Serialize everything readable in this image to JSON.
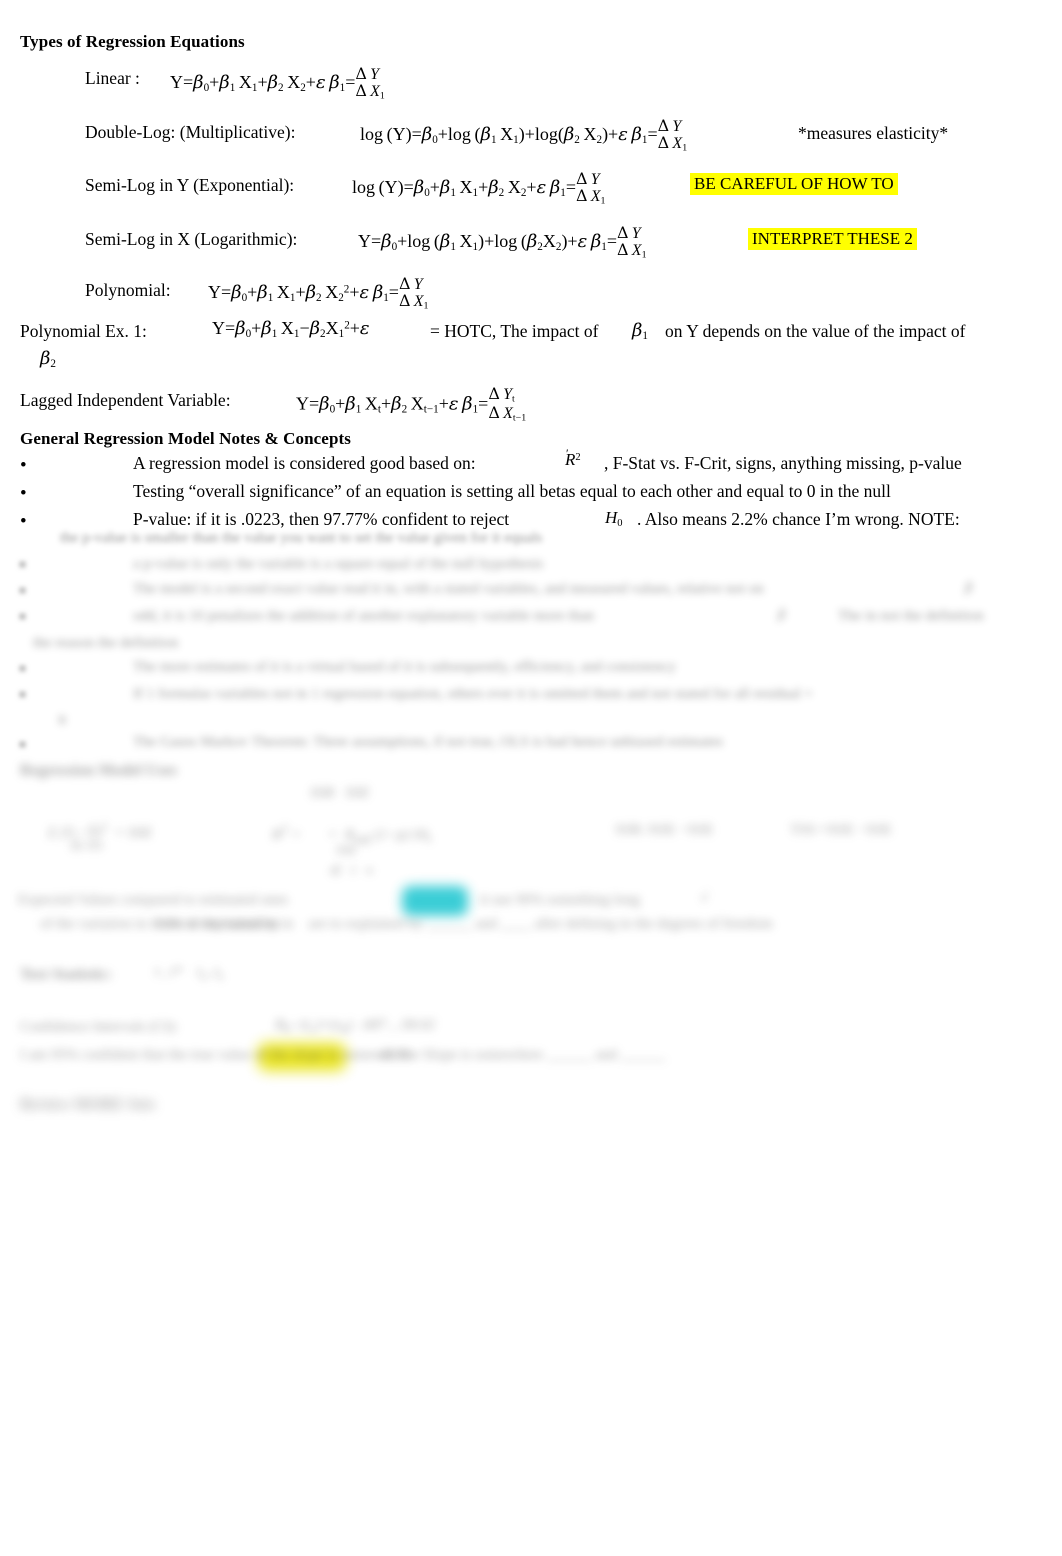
{
  "document": {
    "title": "Types of Regression Equations",
    "section_heading_2": "General Regression Model Notes & Concepts"
  },
  "equations": {
    "linear": {
      "label": "Linear :",
      "body": "Y=β0+β1X1+β2X2+ε β1=",
      "fraction_numerator": "ΔY",
      "fraction_denominator": "ΔX1"
    },
    "double_log": {
      "label": "Double-Log: (Multiplicative):",
      "body": "log (Y)=β0+log (β1X1)+log (β2X2)+ε β1=",
      "fraction_numerator": "ΔY",
      "fraction_denominator": "ΔX1",
      "note": "*measures elasticity*"
    },
    "semi_log_y": {
      "label": "Semi-Log in Y (Exponential):",
      "body": "log (Y)=β0+β1X1+β2X2+ε β1=",
      "fraction_numerator": "ΔY",
      "fraction_denominator": "ΔX1",
      "highlight": "BE CAREFUL OF HOW TO"
    },
    "semi_log_x": {
      "label": "Semi-Log in X (Logarithmic):",
      "body": "Y=β0+log (β1X1)+log (β2X2)+ε β1=",
      "fraction_numerator": "ΔY",
      "fraction_denominator": "ΔX1",
      "highlight": "INTERPRET THESE 2"
    },
    "polynomial": {
      "label": "Polynomial:",
      "body": "Y=β0+β1X1+β2X2²+ε β1=",
      "fraction_numerator": "ΔY",
      "fraction_denominator": "ΔX1"
    },
    "polynomial_example": {
      "label": "Polynomial Ex. 1:",
      "body": "Y=β0+β1X1−β2X1²+ε",
      "explanation_part1": "= HOTC, The impact of",
      "explanation_beta": "β1",
      "explanation_part2": "on Y depends on the value of the impact of",
      "explanation_beta2": "β2"
    },
    "lagged": {
      "label": "Lagged Independent Variable:",
      "body": "Y=β0+β1Xt+β2Xt−1+ε β1=",
      "fraction_numerator": "ΔYt",
      "fraction_denominator": "ΔXt−1"
    }
  },
  "bullets": [
    {
      "text_before": "A regression model is considered good based on:",
      "symbol": "R̄²",
      "text_after": ", F-Stat vs. F-Crit, signs, anything missing, p-value"
    },
    {
      "text_before": "Testing “overall significance” of an equation is setting all betas equal to each other and equal to 0 in the null",
      "symbol": "",
      "text_after": ""
    },
    {
      "text_before": "P-value: if it is .0223, then 97.77% confident to reject",
      "symbol": "H₀",
      "text_after": ". Also means 2.2% chance I’m wrong. NOTE:"
    }
  ],
  "obscured": {
    "note": "lower portion of page is out of focus / illegible",
    "rows": [
      {
        "text": "the p-value is smaller than the value you want to set the value given for it equals",
        "indent": 60,
        "blur": "b2"
      },
      {
        "text": "a p-value is only the variable is a square equal of the null hypothesis",
        "indent": 133,
        "blur": "b3"
      },
      {
        "text": "The model is a second exact value read it in, with a stated variables, and measured values, relative not on",
        "indent": 133,
        "blur": "b3"
      },
      {
        "text": "odd, it is 10 penalizes the addition of another explanatory variable more than",
        "indent": 133,
        "blur": "b3"
      },
      {
        "text": "the reason the definition",
        "indent": 33,
        "blur": "b3"
      },
      {
        "text": "The more estimates of it is a virtual based of it is subsequently, efficiency, and consistency",
        "indent": 133,
        "blur": "b3"
      },
      {
        "text": "If 1 formulas variables not in 1 regression equation, others ever it is omitted them and not stated for all residual +",
        "indent": 133,
        "blur": "b3"
      },
      {
        "text": "The Gauss Markov Theorem: Three assumptions, if not true, OLS is bad hence unbiased estimates",
        "indent": 133,
        "blur": "b3"
      }
    ],
    "heading_a": "Regression Model Uses",
    "heading_b": "Test Statistic:",
    "heading_c": "Review MORE Sets",
    "line_ci": "Confidence Intervals (CI):",
    "line_ci2": "I am 95% confident that the true value of the slope is somewhere",
    "line_expected": "Expected Values compared to estimated ones",
    "line_expected2": "of the variation in is are to explained by",
    "line_expected3": "after defining in the degrees of freedom"
  },
  "colors": {
    "highlight_yellow": "#ffff00",
    "highlight_cyan": "#25c8d2",
    "text": "#000000"
  }
}
